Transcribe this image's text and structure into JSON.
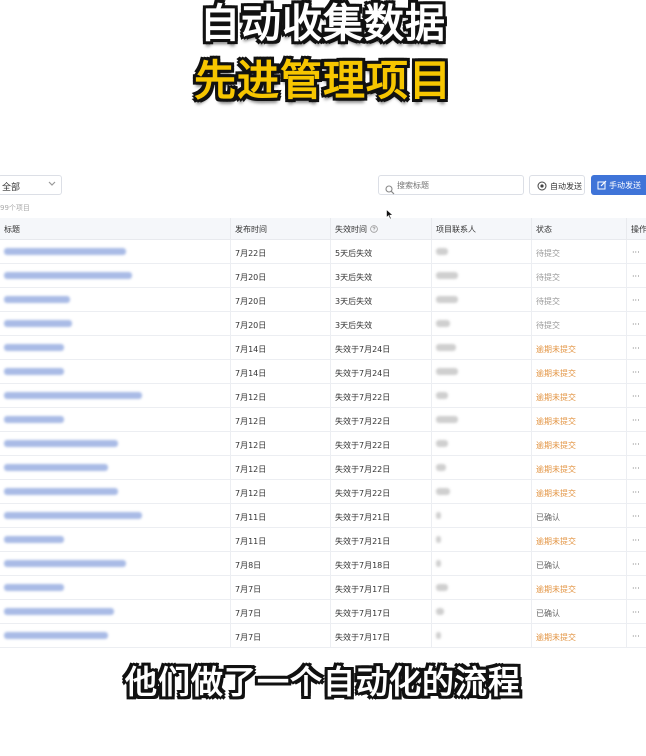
{
  "overlay": {
    "title_line1": "自动收集数据",
    "title_line2": "先进管理项目",
    "subtitle": "他们做了一个自动化的流程"
  },
  "toolbar": {
    "filter_value": "全部",
    "search_placeholder": "搜索标题",
    "auto_send_label": "自动发送",
    "manual_send_label": "手动发送"
  },
  "list": {
    "count_text": "99个项目"
  },
  "table": {
    "headers": {
      "title": "标题",
      "publish_time": "发布时间",
      "expire_time": "失效时间",
      "contact": "项目联系人",
      "status": "状态",
      "action": "操作"
    },
    "action_glyph": "···",
    "rows": [
      {
        "publish": "7月22日",
        "expire": "5天后失效",
        "status": "待提交",
        "status_kind": "pending"
      },
      {
        "publish": "7月20日",
        "expire": "3天后失效",
        "status": "待提交",
        "status_kind": "pending"
      },
      {
        "publish": "7月20日",
        "expire": "3天后失效",
        "status": "待提交",
        "status_kind": "pending"
      },
      {
        "publish": "7月20日",
        "expire": "3天后失效",
        "status": "待提交",
        "status_kind": "pending"
      },
      {
        "publish": "7月14日",
        "expire": "失效于7月24日",
        "status": "逾期未提交",
        "status_kind": "overdue"
      },
      {
        "publish": "7月14日",
        "expire": "失效于7月24日",
        "status": "逾期未提交",
        "status_kind": "overdue"
      },
      {
        "publish": "7月12日",
        "expire": "失效于7月22日",
        "status": "逾期未提交",
        "status_kind": "overdue"
      },
      {
        "publish": "7月12日",
        "expire": "失效于7月22日",
        "status": "逾期未提交",
        "status_kind": "overdue"
      },
      {
        "publish": "7月12日",
        "expire": "失效于7月22日",
        "status": "逾期未提交",
        "status_kind": "overdue"
      },
      {
        "publish": "7月12日",
        "expire": "失效于7月22日",
        "status": "逾期未提交",
        "status_kind": "overdue"
      },
      {
        "publish": "7月12日",
        "expire": "失效于7月22日",
        "status": "逾期未提交",
        "status_kind": "overdue"
      },
      {
        "publish": "7月11日",
        "expire": "失效于7月21日",
        "status": "已确认",
        "status_kind": "confirmed"
      },
      {
        "publish": "7月11日",
        "expire": "失效于7月21日",
        "status": "逾期未提交",
        "status_kind": "overdue"
      },
      {
        "publish": "7月8日",
        "expire": "失效于7月18日",
        "status": "已确认",
        "status_kind": "confirmed"
      },
      {
        "publish": "7月7日",
        "expire": "失效于7月17日",
        "status": "逾期未提交",
        "status_kind": "overdue"
      },
      {
        "publish": "7月7日",
        "expire": "失效于7月17日",
        "status": "已确认",
        "status_kind": "confirmed"
      },
      {
        "publish": "7月7日",
        "expire": "失效于7月17日",
        "status": "逾期未提交",
        "status_kind": "overdue"
      }
    ]
  },
  "colors": {
    "primary": "#3f74d8",
    "overdue": "#e39544",
    "pending": "#999999",
    "caption_yellow": "#f7c600"
  }
}
